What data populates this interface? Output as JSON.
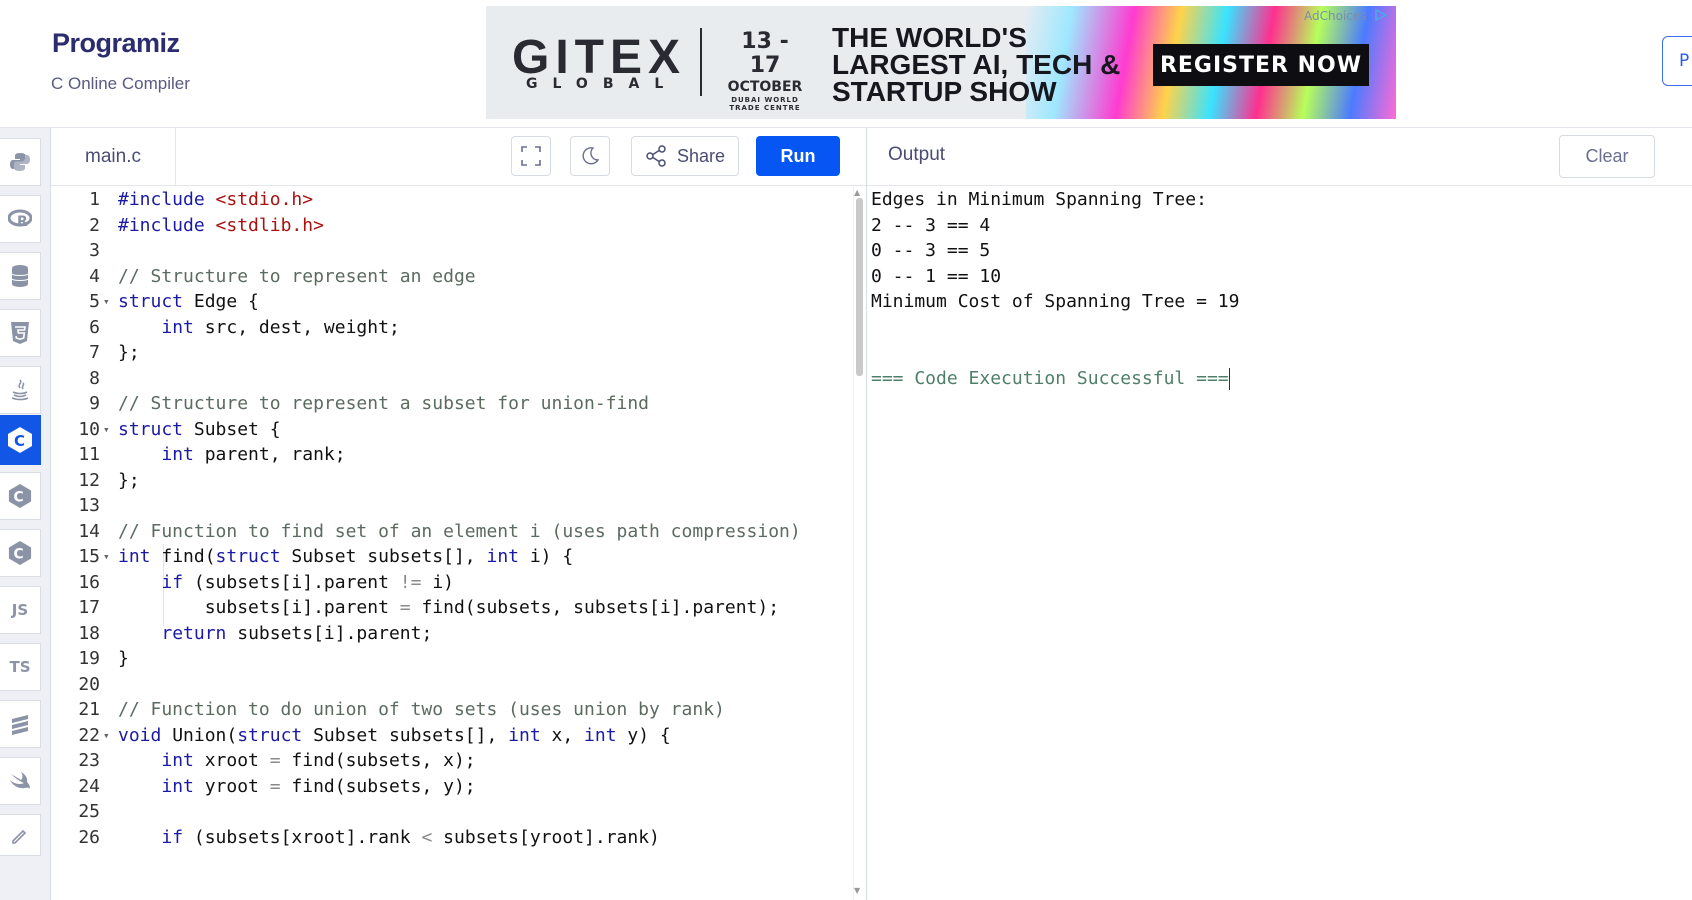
{
  "brand": {
    "name": "Programiz",
    "subtitle": "C Online Compiler"
  },
  "ad": {
    "brand": "GITEX",
    "brand_sub": "GLOBAL",
    "dates": "13 - 17",
    "month": "OCTOBER",
    "venue_line1": "DUBAI WORLD",
    "venue_line2": "TRADE CENTRE",
    "headline_1": "THE WORLD'S",
    "headline_2": "LARGEST AI, TECH &",
    "headline_3": "STARTUP SHOW",
    "cta": "REGISTER NOW",
    "adchoices": "AdChoices"
  },
  "header": {
    "right_button": "P"
  },
  "sidebar": {
    "items": [
      {
        "name": "python",
        "label": ""
      },
      {
        "name": "r",
        "label": ""
      },
      {
        "name": "sql",
        "label": ""
      },
      {
        "name": "html",
        "label": ""
      },
      {
        "name": "java",
        "label": ""
      },
      {
        "name": "c",
        "label": "C",
        "active": true
      },
      {
        "name": "cpp",
        "label": "C"
      },
      {
        "name": "csharp",
        "label": "C"
      },
      {
        "name": "js",
        "label": "JS"
      },
      {
        "name": "ts",
        "label": "TS"
      },
      {
        "name": "go",
        "label": ""
      },
      {
        "name": "swift",
        "label": ""
      }
    ]
  },
  "editor": {
    "file_name": "main.c",
    "share_label": "Share",
    "run_label": "Run",
    "lines": [
      {
        "n": "1",
        "fold": false,
        "tokens": [
          [
            "kw",
            "#include "
          ],
          [
            "str",
            "<stdio.h>"
          ]
        ]
      },
      {
        "n": "2",
        "fold": false,
        "tokens": [
          [
            "kw",
            "#include "
          ],
          [
            "str",
            "<stdlib.h>"
          ]
        ]
      },
      {
        "n": "3",
        "fold": false,
        "tokens": []
      },
      {
        "n": "4",
        "fold": false,
        "tokens": [
          [
            "cm",
            "// Structure to represent an edge"
          ]
        ]
      },
      {
        "n": "5",
        "fold": true,
        "tokens": [
          [
            "kw",
            "struct"
          ],
          [
            "t",
            " Edge {"
          ]
        ]
      },
      {
        "n": "6",
        "fold": false,
        "tokens": [
          [
            "t",
            "    "
          ],
          [
            "kw",
            "int"
          ],
          [
            "t",
            " src, dest, weight;"
          ]
        ]
      },
      {
        "n": "7",
        "fold": false,
        "tokens": [
          [
            "t",
            "};"
          ]
        ]
      },
      {
        "n": "8",
        "fold": false,
        "tokens": []
      },
      {
        "n": "9",
        "fold": false,
        "tokens": [
          [
            "cm",
            "// Structure to represent a subset for union-find"
          ]
        ]
      },
      {
        "n": "10",
        "fold": true,
        "tokens": [
          [
            "kw",
            "struct"
          ],
          [
            "t",
            " Subset {"
          ]
        ]
      },
      {
        "n": "11",
        "fold": false,
        "tokens": [
          [
            "t",
            "    "
          ],
          [
            "kw",
            "int"
          ],
          [
            "t",
            " parent, rank;"
          ]
        ]
      },
      {
        "n": "12",
        "fold": false,
        "tokens": [
          [
            "t",
            "};"
          ]
        ]
      },
      {
        "n": "13",
        "fold": false,
        "tokens": []
      },
      {
        "n": "14",
        "fold": false,
        "tokens": [
          [
            "cm",
            "// Function to find set of an element i (uses path compression)"
          ]
        ]
      },
      {
        "n": "15",
        "fold": true,
        "tokens": [
          [
            "kw",
            "int"
          ],
          [
            "t",
            " find("
          ],
          [
            "kw",
            "struct"
          ],
          [
            "t",
            " Subset subsets[], "
          ],
          [
            "kw",
            "int"
          ],
          [
            "t",
            " i) {"
          ]
        ]
      },
      {
        "n": "16",
        "fold": false,
        "tokens": [
          [
            "t",
            "    "
          ],
          [
            "kw",
            "if"
          ],
          [
            "t",
            " (subsets[i].parent "
          ],
          [
            "op",
            "!="
          ],
          [
            "t",
            " i)"
          ]
        ]
      },
      {
        "n": "17",
        "fold": false,
        "tokens": [
          [
            "t",
            "        subsets[i].parent "
          ],
          [
            "op",
            "="
          ],
          [
            "t",
            " find(subsets, subsets[i].parent);"
          ]
        ]
      },
      {
        "n": "18",
        "fold": false,
        "tokens": [
          [
            "t",
            "    "
          ],
          [
            "kw",
            "return"
          ],
          [
            "t",
            " subsets[i].parent;"
          ]
        ]
      },
      {
        "n": "19",
        "fold": false,
        "tokens": [
          [
            "t",
            "}"
          ]
        ]
      },
      {
        "n": "20",
        "fold": false,
        "tokens": []
      },
      {
        "n": "21",
        "fold": false,
        "tokens": [
          [
            "cm",
            "// Function to do union of two sets (uses union by rank)"
          ]
        ]
      },
      {
        "n": "22",
        "fold": true,
        "tokens": [
          [
            "kw",
            "void"
          ],
          [
            "t",
            " Union("
          ],
          [
            "kw",
            "struct"
          ],
          [
            "t",
            " Subset subsets[], "
          ],
          [
            "kw",
            "int"
          ],
          [
            "t",
            " x, "
          ],
          [
            "kw",
            "int"
          ],
          [
            "t",
            " y) {"
          ]
        ]
      },
      {
        "n": "23",
        "fold": false,
        "tokens": [
          [
            "t",
            "    "
          ],
          [
            "kw",
            "int"
          ],
          [
            "t",
            " xroot "
          ],
          [
            "op",
            "="
          ],
          [
            "t",
            " find(subsets, x);"
          ]
        ]
      },
      {
        "n": "24",
        "fold": false,
        "tokens": [
          [
            "t",
            "    "
          ],
          [
            "kw",
            "int"
          ],
          [
            "t",
            " yroot "
          ],
          [
            "op",
            "="
          ],
          [
            "t",
            " find(subsets, y);"
          ]
        ]
      },
      {
        "n": "25",
        "fold": false,
        "tokens": []
      },
      {
        "n": "26",
        "fold": false,
        "tokens": [
          [
            "t",
            "    "
          ],
          [
            "kw",
            "if"
          ],
          [
            "t",
            " (subsets[xroot].rank "
          ],
          [
            "op",
            "<"
          ],
          [
            "t",
            " subsets[yroot].rank)"
          ]
        ]
      }
    ]
  },
  "output": {
    "title": "Output",
    "clear_label": "Clear",
    "lines": [
      {
        "text": "Edges in Minimum Spanning Tree:",
        "kind": "normal"
      },
      {
        "text": "2 -- 3 == 4",
        "kind": "normal"
      },
      {
        "text": "0 -- 3 == 5",
        "kind": "normal"
      },
      {
        "text": "0 -- 1 == 10",
        "kind": "normal"
      },
      {
        "text": "Minimum Cost of Spanning Tree = 19",
        "kind": "normal"
      },
      {
        "text": "",
        "kind": "normal"
      },
      {
        "text": "",
        "kind": "normal"
      },
      {
        "text": "=== Code Execution Successful ===",
        "kind": "success"
      }
    ]
  },
  "colors": {
    "run_button": "#0556f3",
    "active_language": "#1256e6",
    "keyword": "#1a1aa6",
    "string": "#a11",
    "comment": "#5b6b60"
  }
}
